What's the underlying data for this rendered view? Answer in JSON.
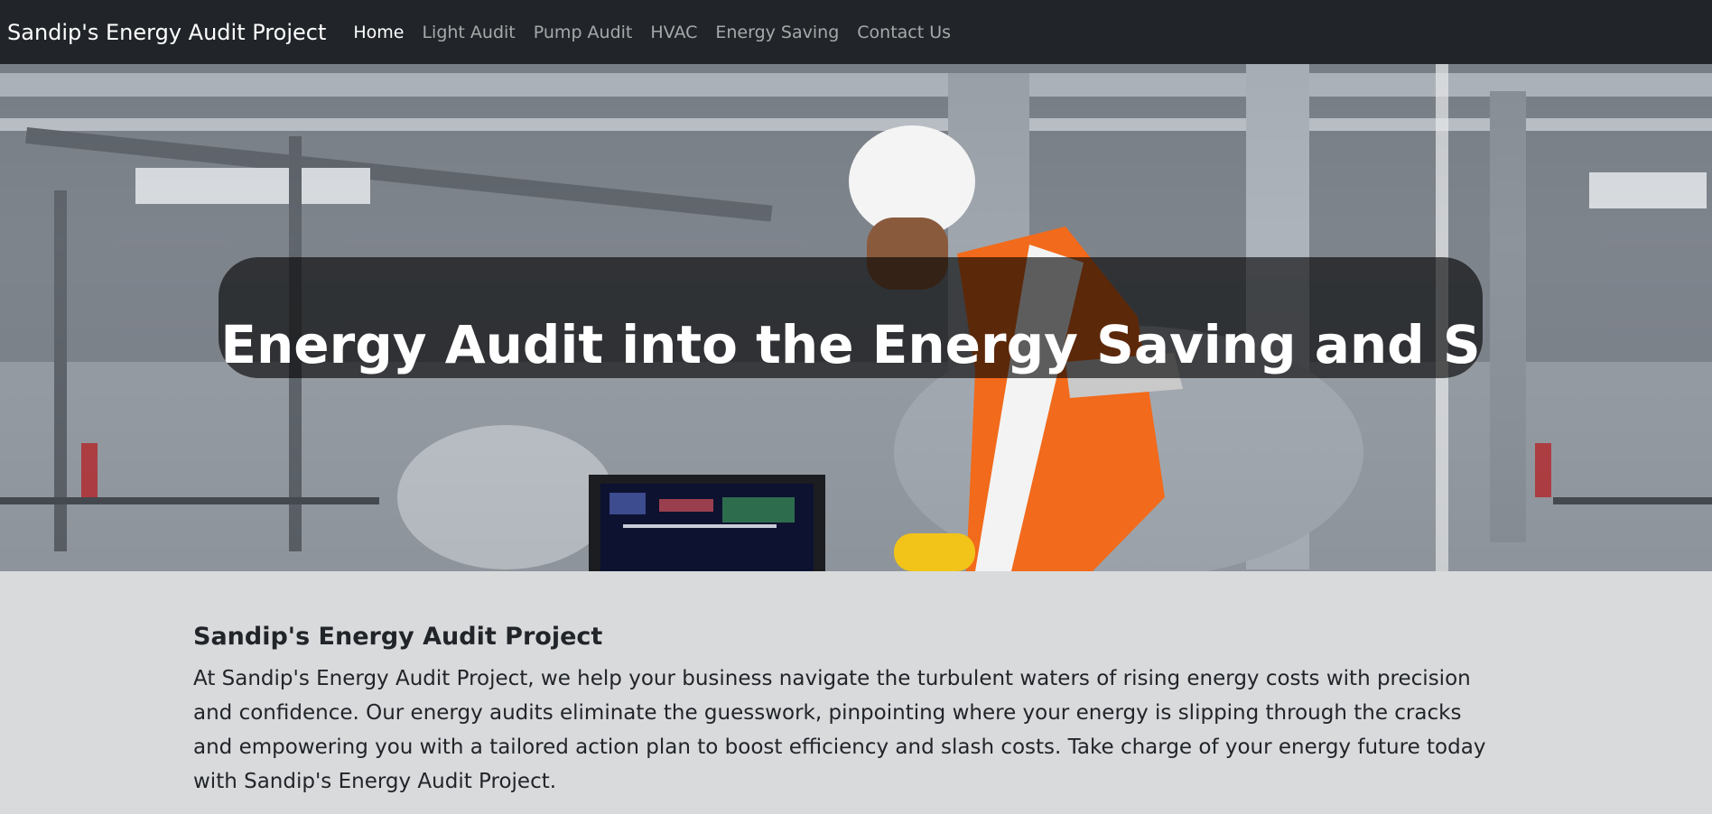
{
  "navbar": {
    "brand": "Sandip's Energy Audit Project",
    "links": [
      {
        "label": "Home",
        "active": true
      },
      {
        "label": "Light Audit",
        "active": false
      },
      {
        "label": "Pump Audit",
        "active": false
      },
      {
        "label": "HVAC",
        "active": false
      },
      {
        "label": "Energy Saving",
        "active": false
      },
      {
        "label": "Contact Us",
        "active": false
      }
    ]
  },
  "hero": {
    "heading": "Energy Audit into the Energy Saving and S",
    "image": "industrial-worker-photo"
  },
  "about": {
    "title": "Sandip's Energy Audit Project",
    "body": "At Sandip's Energy Audit Project, we help your business navigate the turbulent waters of rising energy costs with precision and confidence. Our energy audits eliminate the guesswork, pinpointing where your energy is slipping through the cracks and empowering you with a tailored action plan to boost efficiency and slash costs. Take charge of your energy future today with Sandip's Energy Audit Project."
  },
  "colors": {
    "navbar_bg": "#212529",
    "page_bg": "#d9dadc",
    "vest_orange": "#f26a1b"
  }
}
